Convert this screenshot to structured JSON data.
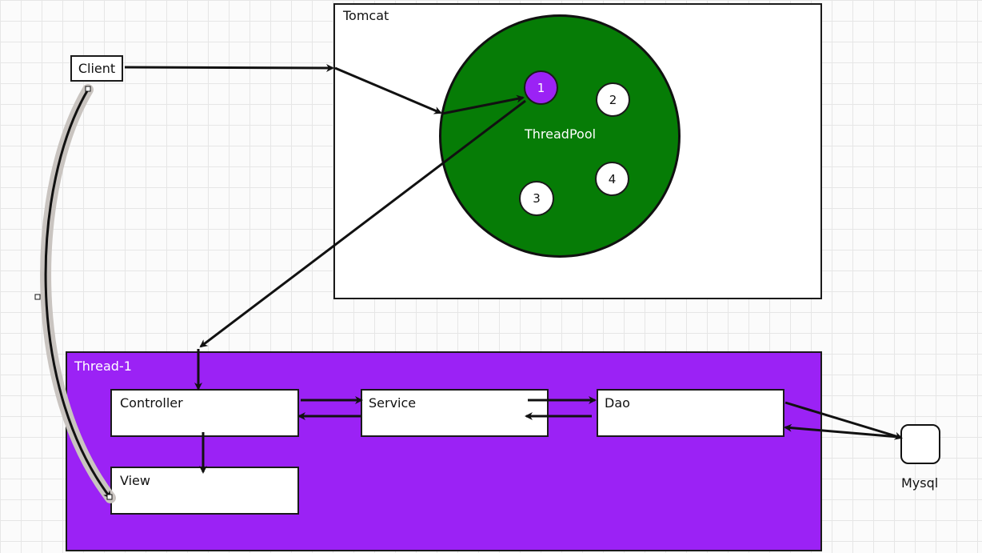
{
  "client": {
    "label": "Client"
  },
  "tomcat": {
    "title": "Tomcat",
    "pool": {
      "label": "ThreadPool",
      "color": "#067c06",
      "threads": [
        "1",
        "2",
        "3",
        "4"
      ],
      "active_thread": "1",
      "active_color": "#9b22f5"
    }
  },
  "thread": {
    "title": "Thread-1",
    "color": "#9b22f5",
    "components": {
      "controller": "Controller",
      "service": "Service",
      "dao": "Dao",
      "view": "View"
    }
  },
  "database": {
    "label": "Mysql"
  }
}
